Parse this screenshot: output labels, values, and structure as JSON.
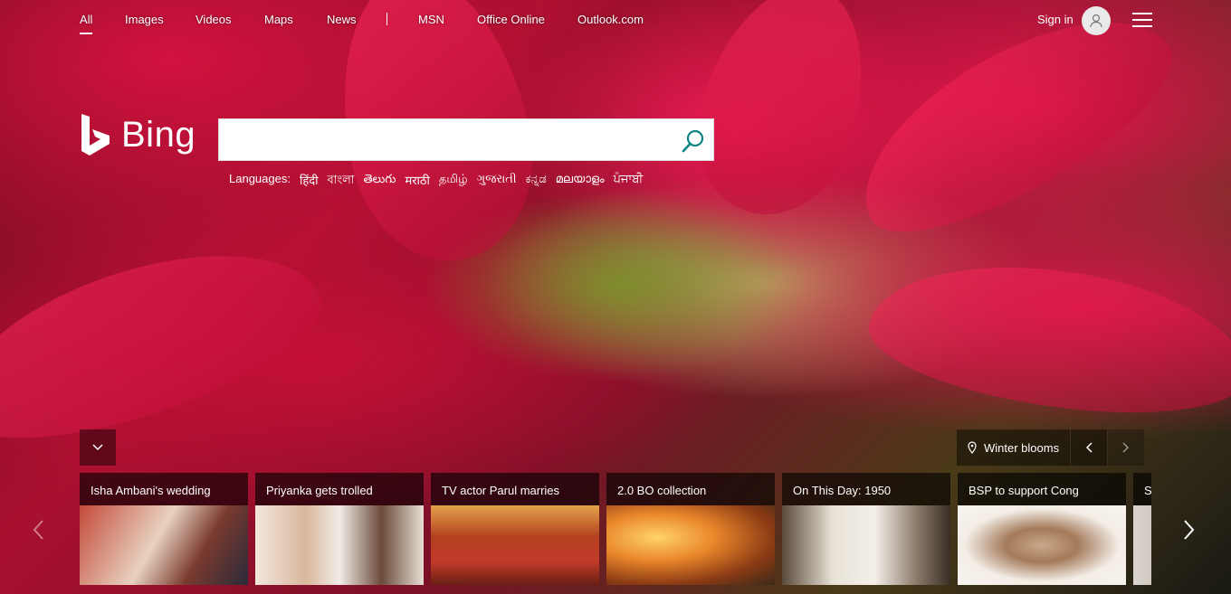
{
  "nav": {
    "items": [
      {
        "label": "All",
        "active": true
      },
      {
        "label": "Images"
      },
      {
        "label": "Videos"
      },
      {
        "label": "Maps"
      },
      {
        "label": "News"
      },
      {
        "label": "MSN"
      },
      {
        "label": "Office Online"
      },
      {
        "label": "Outlook.com"
      }
    ],
    "sign_in": "Sign in"
  },
  "logo": {
    "text": "Bing"
  },
  "search": {
    "value": "",
    "placeholder": ""
  },
  "languages": {
    "label": "Languages:",
    "items": [
      "हिंदी",
      "বাংলা",
      "తెలుగు",
      "मराठी",
      "தமிழ்",
      "ગુજરાતી",
      "ಕನ್ನಡ",
      "മലയാളം",
      "ਪੰਜਾਬੀ"
    ]
  },
  "image_info": {
    "location_label": "Winter blooms"
  },
  "news": [
    {
      "title": "Isha Ambani's wedding",
      "colors": [
        "#c44a3a",
        "#e8d2c0"
      ]
    },
    {
      "title": "Priyanka gets trolled",
      "colors": [
        "#f2e6dc",
        "#6b4a3a"
      ]
    },
    {
      "title": "TV actor Parul marries",
      "colors": [
        "#b3401f",
        "#e4a24a"
      ]
    },
    {
      "title": "2.0 BO collection",
      "colors": [
        "#e9862b",
        "#3a2a1a"
      ]
    },
    {
      "title": "On This Day: 1950",
      "colors": [
        "#e8e2d6",
        "#5a4a3a"
      ]
    },
    {
      "title": "BSP to support Cong",
      "colors": [
        "#f3ede6",
        "#c9a98a"
      ]
    },
    {
      "title": "S",
      "colors": [
        "#d9d4cc",
        "#8a7a6a"
      ]
    }
  ],
  "colors": {
    "accent": "#0c8484",
    "overlay": "rgba(0,0,0,0.45)"
  }
}
